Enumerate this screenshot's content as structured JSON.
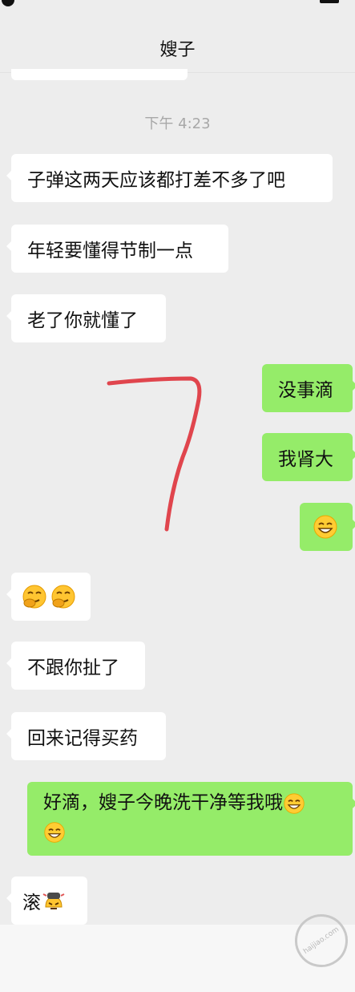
{
  "header": {
    "title": "嫂子"
  },
  "timestamp": "下午 4:23",
  "messages": [
    {
      "side": "left",
      "text": "子弹这两天应该都打差不多了吧"
    },
    {
      "side": "left",
      "text": "年轻要懂得节制一点"
    },
    {
      "side": "left",
      "text": "老了你就懂了"
    },
    {
      "side": "right",
      "text": "没事滴"
    },
    {
      "side": "right",
      "text": "我肾大"
    },
    {
      "side": "right",
      "text": "",
      "emojis": [
        "grin-emoji"
      ]
    },
    {
      "side": "left",
      "text": "",
      "emojis": [
        "hehe-emoji",
        "hehe-emoji"
      ]
    },
    {
      "side": "left",
      "text": "不跟你扯了"
    },
    {
      "side": "left",
      "text": "回来记得买药"
    },
    {
      "side": "right",
      "text": "好滴，嫂子今晚洗干净等我哦",
      "emojis": [
        "grin-emoji",
        "grin-emoji"
      ]
    },
    {
      "side": "left",
      "text": "滚",
      "emojis": [
        "annoyed-emoji"
      ]
    }
  ],
  "annotation": {
    "shape": "7",
    "color": "#e0454d"
  },
  "watermark": {
    "text": "haijiao.com"
  },
  "colors": {
    "background": "#ededed",
    "my_bubble": "#95ec69",
    "their_bubble": "#ffffff"
  }
}
